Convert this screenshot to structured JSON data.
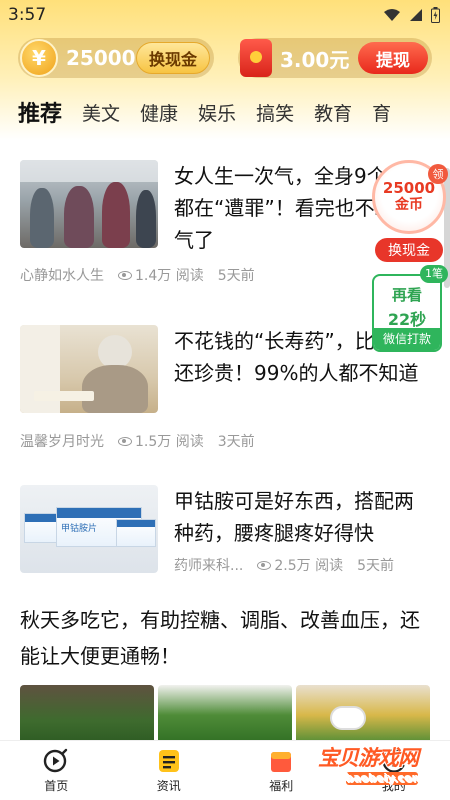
{
  "status_bar": {
    "time": "3:57"
  },
  "wallet": {
    "coins": "25000",
    "coin_symbol": "¥",
    "exchange_label": "换现金",
    "cash": "3.00元",
    "withdraw_label": "提现"
  },
  "tabs": [
    "推荐",
    "美文",
    "健康",
    "娱乐",
    "搞笑",
    "教育",
    "育"
  ],
  "articles": [
    {
      "title": "女人生一次气，全身9个器官都在“遭罪”！看完也不敢生气了",
      "source": "心静如水人生",
      "views": "1.4万 阅读",
      "time": "5天前"
    },
    {
      "title": "不花钱的“长寿药”，比金子还珍贵！99%的人都不知道",
      "source": "温馨岁月时光",
      "views": "1.5万 阅读",
      "time": "3天前"
    },
    {
      "title": "甲钴胺可是好东西，搭配两种药，腰疼腿疼好得快",
      "source": "药师来科...",
      "views": "2.5万 阅读",
      "time": "5天前"
    }
  ],
  "thumb3_label": "甲钴胺片",
  "big_article": {
    "title": "秋天多吃它，有助控糖、调脂、改善血压，还能让大便更通畅！"
  },
  "float_widget": {
    "ling": "领",
    "coins_line1": "25000",
    "coins_line2": "金币",
    "exchange_label": "换现金",
    "one_badge": "1笔",
    "watch_line1": "再看",
    "watch_line2": "22秒",
    "watch_line3": "微信打款"
  },
  "bottom_nav": [
    {
      "label": "首页",
      "icon": "play-circle-icon"
    },
    {
      "label": "资讯",
      "icon": "news-icon"
    },
    {
      "label": "福利",
      "icon": "gift-icon"
    },
    {
      "label": "我的",
      "icon": "user-icon"
    }
  ],
  "watermark": {
    "main": "宝贝游戏网",
    "sub": "baobeiy.com"
  },
  "colors": {
    "accent_gold": "#ffd24a",
    "accent_red": "#e8281c",
    "accent_green": "#2fb55c"
  }
}
